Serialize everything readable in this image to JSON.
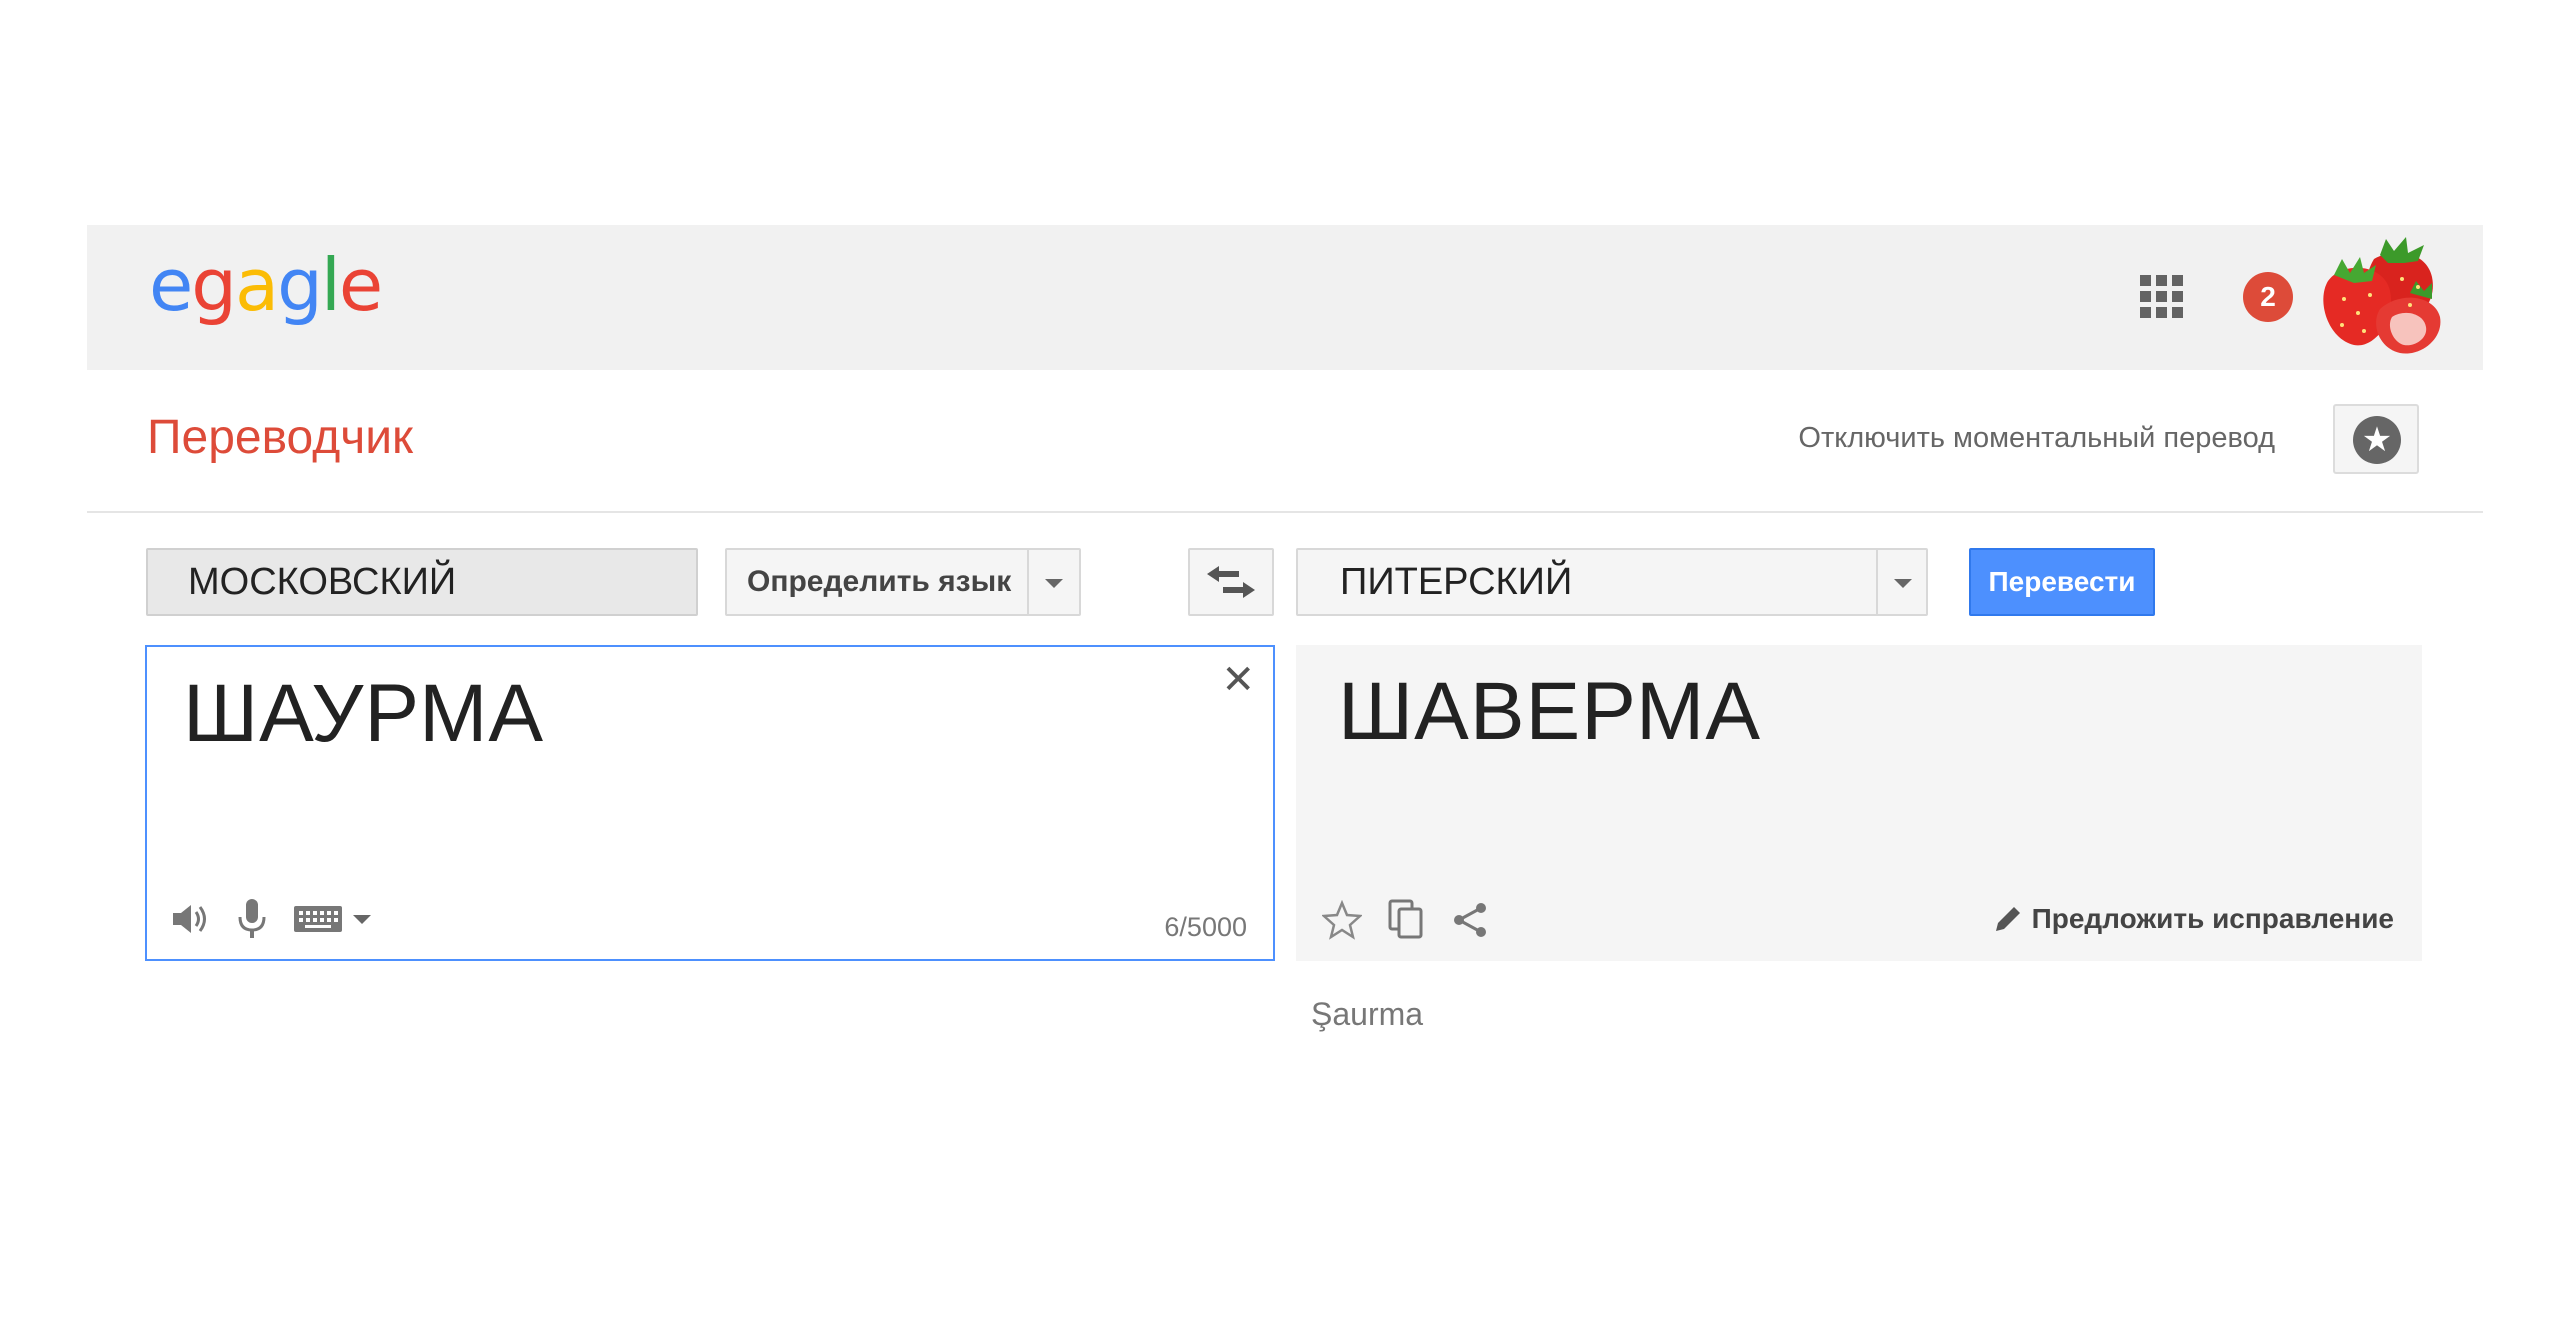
{
  "header": {
    "logo_letters": [
      {
        "ch": "e",
        "color": "#4285f4"
      },
      {
        "ch": "g",
        "color": "#ea4335"
      },
      {
        "ch": "a",
        "color": "#fbbc05"
      },
      {
        "ch": "g",
        "color": "#4285f4"
      },
      {
        "ch": "l",
        "color": "#34a853"
      },
      {
        "ch": "e",
        "color": "#ea4335"
      }
    ],
    "notification_count": "2",
    "apps_icon": "apps-grid-icon",
    "avatar_icon": "strawberry-avatar"
  },
  "subheader": {
    "title": "Переводчик",
    "instant_toggle": "Отключить моментальный перевод",
    "starred_icon": "star-icon"
  },
  "toolbar": {
    "source_lang": "МОСКОВСКИЙ",
    "detect_lang": "Определить язык",
    "swap_icon": "swap-arrows-icon",
    "target_lang": "ПИТЕРСКИЙ",
    "translate_button": "Перевести"
  },
  "source": {
    "text": "ШАУРМА",
    "char_count": "6/5000",
    "icons": [
      "speaker-icon",
      "microphone-icon",
      "keyboard-icon"
    ]
  },
  "target": {
    "text": "ШАВЕРМА",
    "suggest_edit": "Предложить исправление",
    "transliteration": "Şaurma",
    "icons": [
      "star-outline-icon",
      "copy-icon",
      "share-icon"
    ]
  },
  "colors": {
    "brand_red": "#dd4b39",
    "accent_blue": "#4d90fe"
  }
}
